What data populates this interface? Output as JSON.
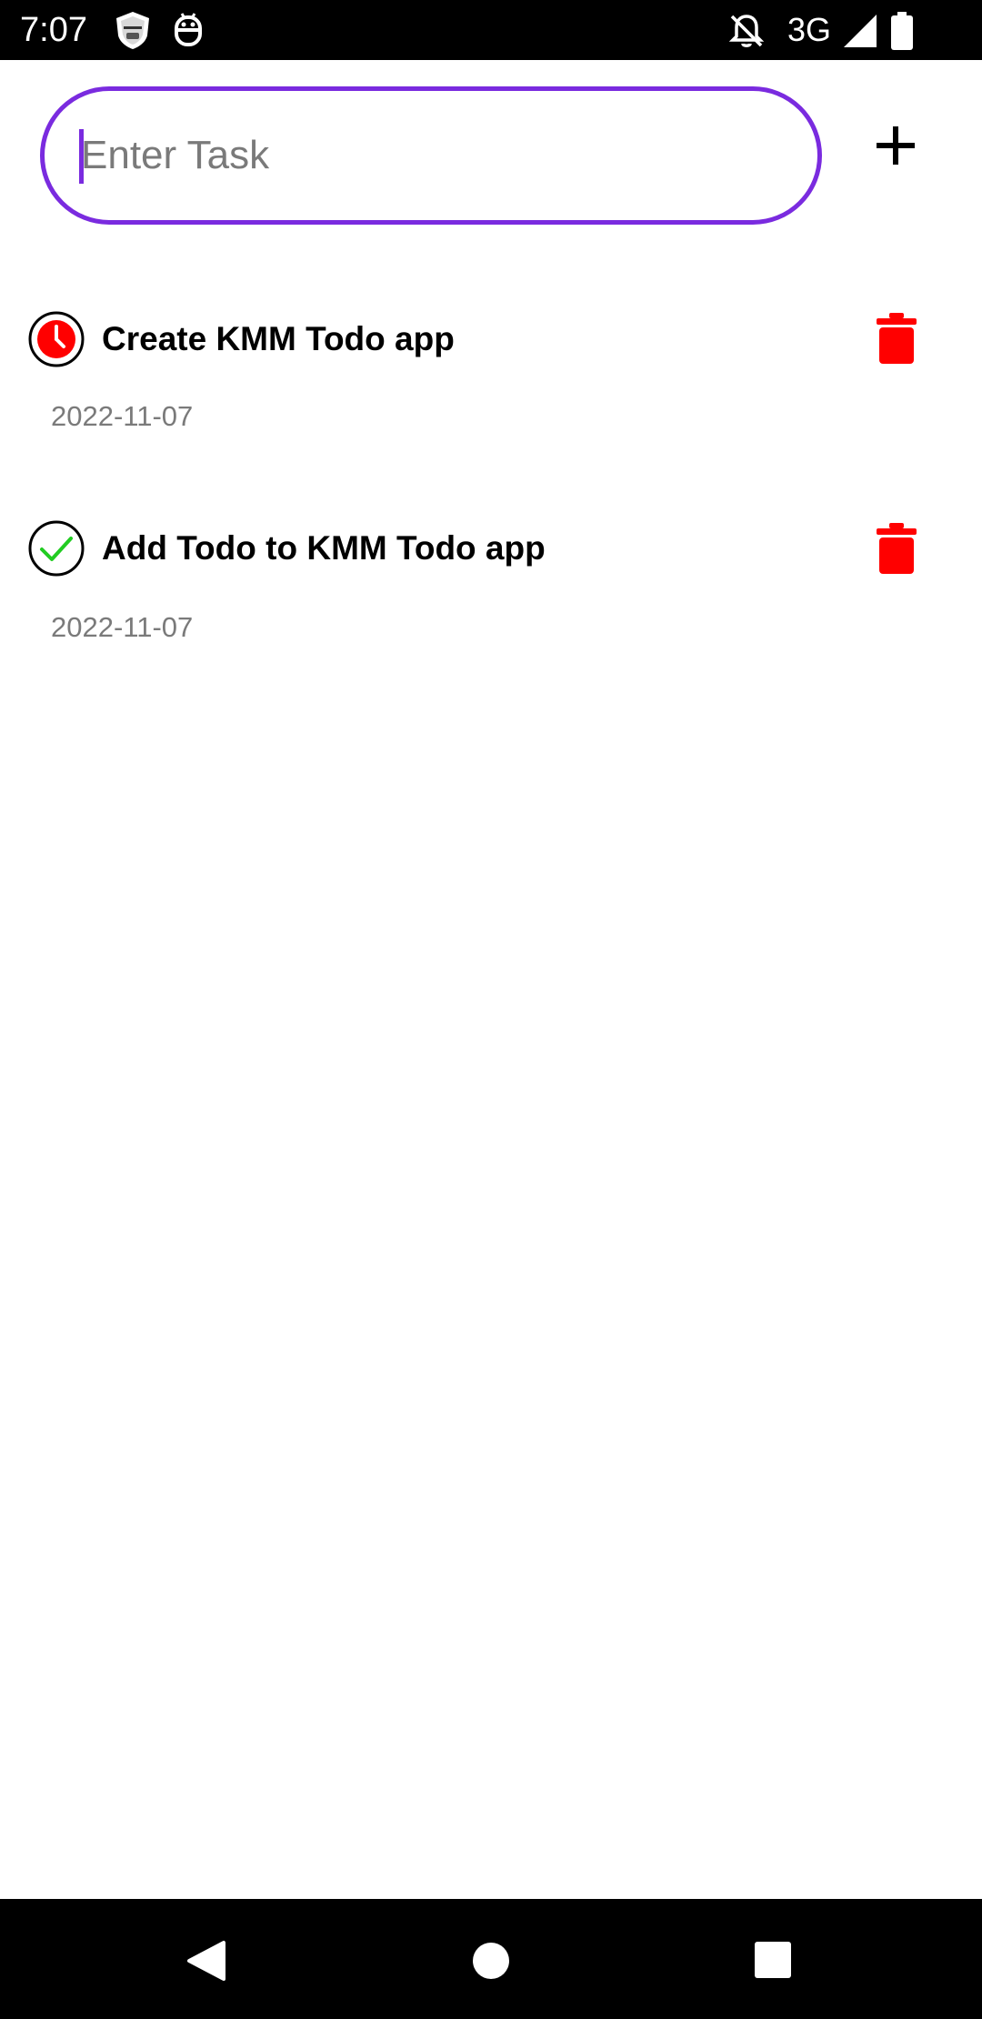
{
  "status_bar": {
    "time": "7:07",
    "network": "3G",
    "icons": [
      "shield-badge-icon",
      "android-head-icon",
      "bell-off-icon",
      "cell-signal-icon",
      "battery-icon"
    ]
  },
  "task_input": {
    "placeholder": "Enter Task",
    "value": "",
    "border_color": "#7a2bdf"
  },
  "add_button": {
    "icon": "plus-icon"
  },
  "tasks": [
    {
      "title": "Create KMM Todo app",
      "date": "2022-11-07",
      "status": "pending",
      "status_icon": "clock-icon"
    },
    {
      "title": "Add Todo to KMM Todo app",
      "date": "2022-11-07",
      "status": "done",
      "status_icon": "check-icon"
    }
  ],
  "colors": {
    "accent": "#7a2bdf",
    "delete": "#ff0000",
    "pending": "#ff0000",
    "done": "#22cc22",
    "date_text": "#7a7a7a"
  },
  "nav_bar": {
    "buttons": [
      "back-icon",
      "home-icon",
      "recents-icon"
    ]
  }
}
